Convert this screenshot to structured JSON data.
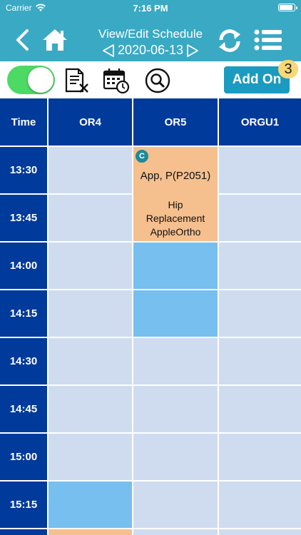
{
  "status_bar": {
    "carrier": "Carrier",
    "time": "7:16 PM"
  },
  "nav": {
    "title": "View/Edit Schedule",
    "date": "2020-06-13",
    "icons": [
      "chevron-left-icon",
      "home-icon",
      "refresh-icon",
      "list-menu-icon"
    ]
  },
  "toolbar": {
    "toggle_on": true,
    "icons": [
      "document-clear-icon",
      "calendar-clock-icon",
      "search-icon"
    ],
    "add_on_label": "Add On",
    "add_on_count": "3"
  },
  "schedule": {
    "time_header": "Time",
    "rooms": [
      "OR4",
      "OR5",
      "ORGU1"
    ],
    "times": [
      "13:30",
      "13:45",
      "14:00",
      "14:15",
      "14:30",
      "14:45",
      "15:00",
      "15:15"
    ],
    "appointment": {
      "badge": "C",
      "patient": "App, P(P2051)",
      "procedure_line1": "Hip",
      "procedure_line2": "Replacement",
      "procedure_line3": "AppleOrtho"
    }
  },
  "colors": {
    "nav_bg": "#3aa9c4",
    "header_bg": "#003a9b",
    "empty_slot": "#cfdcf0",
    "booked_slot": "#76bfee",
    "appointment": "#f5bf8e",
    "add_on_button": "#1a9bbf",
    "toggle": "#4cd964"
  }
}
